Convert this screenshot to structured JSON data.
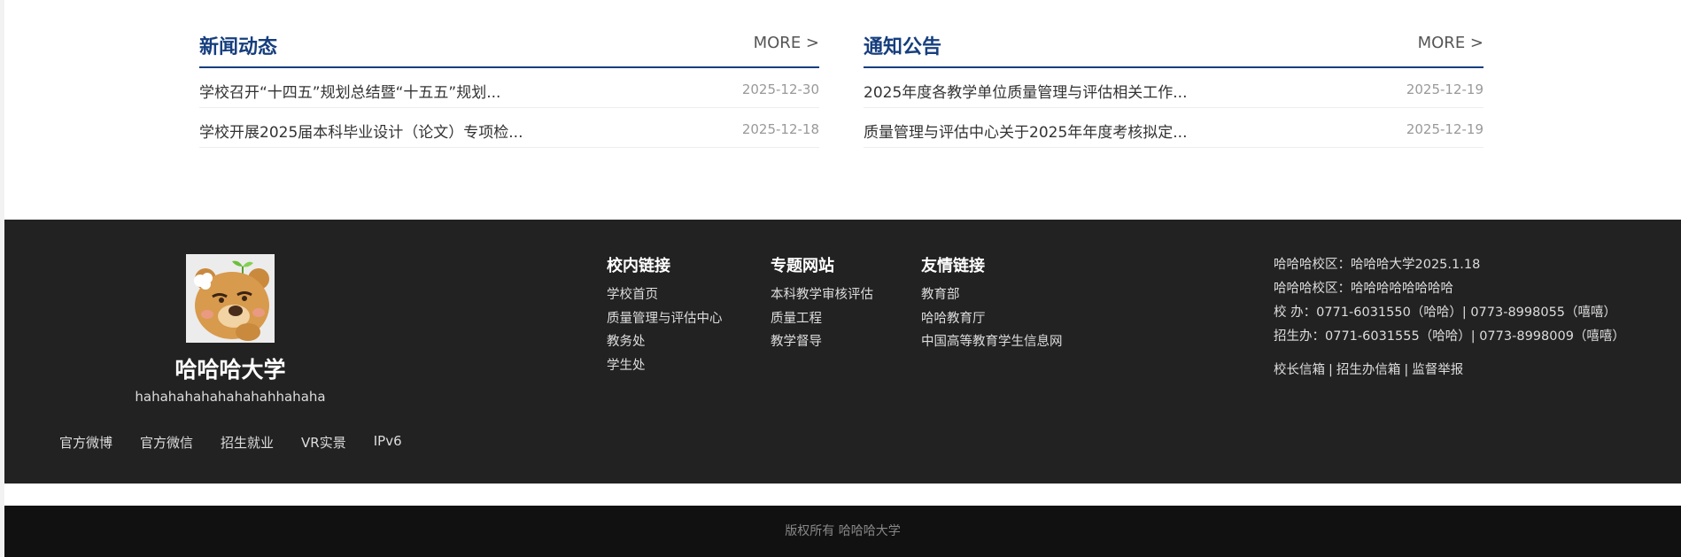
{
  "news": {
    "title": "新闻动态",
    "more": "MORE >",
    "items": [
      {
        "title": "学校召开“十四五”规划总结暨“十五五”规划...",
        "date": "2025-12-30"
      },
      {
        "title": "学校开展2025届本科毕业设计（论文）专项检...",
        "date": "2025-12-18"
      }
    ]
  },
  "notice": {
    "title": "通知公告",
    "more": "MORE >",
    "items": [
      {
        "title": "2025年度各教学单位质量管理与评估相关工作...",
        "date": "2025-12-19"
      },
      {
        "title": "质量管理与评估中心关于2025年年度考核拟定...",
        "date": "2025-12-19"
      }
    ]
  },
  "footer": {
    "school_name": "哈哈哈大学",
    "school_sub": "hahahahahahahahahhahaha",
    "social": [
      "官方微博",
      "官方微信",
      "招生就业",
      "VR实景",
      "IPv6"
    ],
    "campus_links": {
      "title": "校内链接",
      "items": [
        "学校首页",
        "质量管理与评估中心",
        "教务处",
        "学生处"
      ]
    },
    "topic_links": {
      "title": "专题网站",
      "items": [
        "本科教学审核评估",
        "质量工程",
        "教学督导"
      ]
    },
    "friend_links": {
      "title": "友情链接",
      "items": [
        "教育部",
        "哈哈教育厅",
        "中国高等教育学生信息网"
      ]
    },
    "contact": [
      "哈哈哈校区：哈哈哈大学2025.1.18",
      "哈哈哈校区：哈哈哈哈哈哈哈哈",
      "校 办：0771-6031550（哈哈）| 0773-8998055（嘻嘻）",
      "招生办：0771-6031555（哈哈）| 0773-8998009（嘻嘻）"
    ],
    "mailbox": [
      "校长信箱",
      "招生办信箱",
      "监督举报"
    ],
    "mailbox_sep": "|"
  },
  "copyright": "版权所有 哈哈哈大学",
  "colors": {
    "accent": "#163e7e",
    "footer_bg": "#222222",
    "copyright_bg": "#111111"
  }
}
